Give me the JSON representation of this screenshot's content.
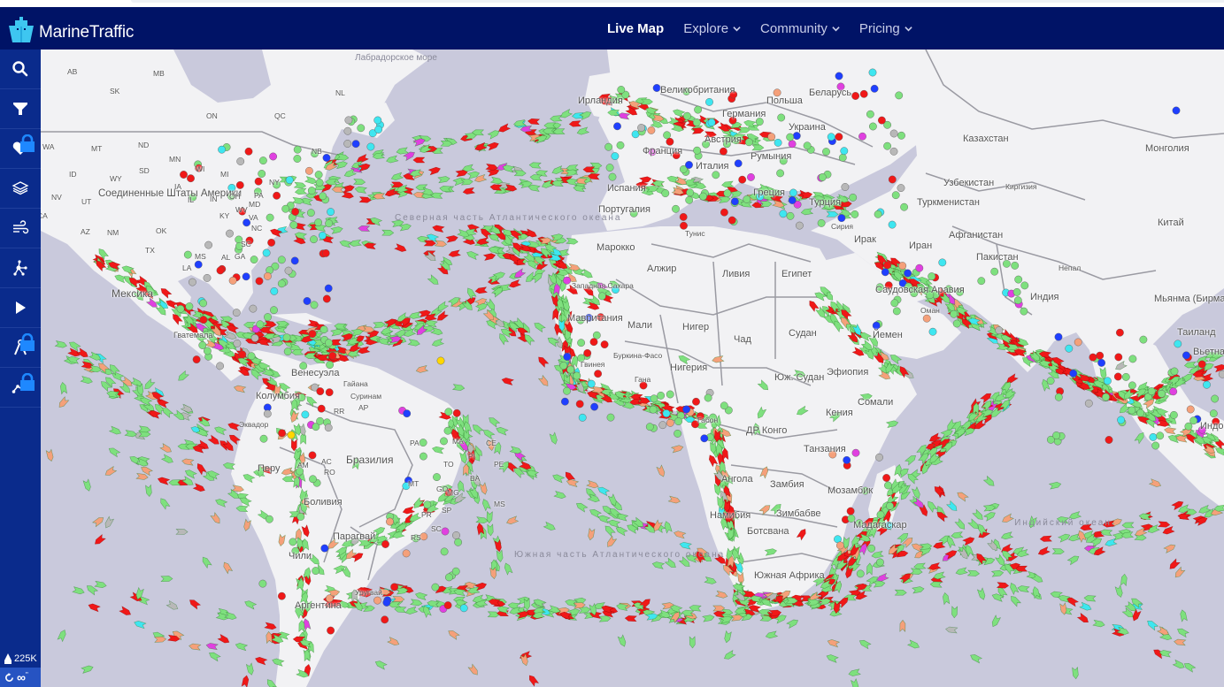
{
  "app": {
    "name": "MarineTraffic",
    "brand_color": "#001366",
    "sidebar_color": "#0a2b8c"
  },
  "nav": {
    "items": [
      {
        "label": "Live Map",
        "active": true,
        "dropdown": false
      },
      {
        "label": "Explore",
        "active": false,
        "dropdown": true
      },
      {
        "label": "Community",
        "active": false,
        "dropdown": true
      },
      {
        "label": "Pricing",
        "active": false,
        "dropdown": true
      }
    ]
  },
  "sidebar": {
    "items": [
      {
        "name": "search",
        "icon": "search-icon",
        "locked": false
      },
      {
        "name": "filters",
        "icon": "filter-icon",
        "locked": false
      },
      {
        "name": "my-fleets",
        "icon": "heart-icon",
        "locked": true
      },
      {
        "name": "map-layers",
        "icon": "layers-icon",
        "locked": false
      },
      {
        "name": "weather",
        "icon": "wind-icon",
        "locked": false
      },
      {
        "name": "density",
        "icon": "network-icon",
        "locked": false
      },
      {
        "name": "playback",
        "icon": "play-icon",
        "locked": false
      },
      {
        "name": "measure-distance",
        "icon": "compass-icon",
        "locked": true
      },
      {
        "name": "route-forecast",
        "icon": "route-icon",
        "locked": true
      }
    ],
    "vessel_count": "225K",
    "refresh_label": "∞",
    "refresh_suffix": "\""
  },
  "map": {
    "vessel_colors": {
      "cargo": "#7ee07e",
      "tanker": "#f01818",
      "passenger": "#1f3fff",
      "high_speed": "#ffd700",
      "tug_special": "#3ee6f0",
      "fishing": "#f5a07a",
      "pleasure": "#e040e0",
      "unknown": "#b8b8b8"
    },
    "labels": {
      "countries": [
        {
          "text": "Соединенные Штаты Америки",
          "kind": "usa"
        },
        {
          "text": "Мексика",
          "kind": "big"
        },
        {
          "text": "Гватемала",
          "kind": ""
        },
        {
          "text": "Венесуэла",
          "kind": ""
        },
        {
          "text": "Колумбия",
          "kind": ""
        },
        {
          "text": "Гайана",
          "kind": "state"
        },
        {
          "text": "Суринам",
          "kind": "state"
        },
        {
          "text": "Эквадор",
          "kind": "state"
        },
        {
          "text": "Перу",
          "kind": ""
        },
        {
          "text": "Бразилия",
          "kind": "big"
        },
        {
          "text": "Боливия",
          "kind": ""
        },
        {
          "text": "Парагвай",
          "kind": ""
        },
        {
          "text": "Уругвай",
          "kind": "state"
        },
        {
          "text": "Аргентина",
          "kind": ""
        },
        {
          "text": "Чили",
          "kind": ""
        },
        {
          "text": "Ирландия",
          "kind": ""
        },
        {
          "text": "Великобритания",
          "kind": ""
        },
        {
          "text": "Франция",
          "kind": ""
        },
        {
          "text": "Испания",
          "kind": ""
        },
        {
          "text": "Португалия",
          "kind": ""
        },
        {
          "text": "Германия",
          "kind": ""
        },
        {
          "text": "Польша",
          "kind": ""
        },
        {
          "text": "Беларусь",
          "kind": ""
        },
        {
          "text": "Украина",
          "kind": ""
        },
        {
          "text": "Австрия",
          "kind": ""
        },
        {
          "text": "Румыния",
          "kind": ""
        },
        {
          "text": "Италия",
          "kind": ""
        },
        {
          "text": "Греция",
          "kind": ""
        },
        {
          "text": "Турция",
          "kind": ""
        },
        {
          "text": "Сирия",
          "kind": "state"
        },
        {
          "text": "Тунис",
          "kind": "state"
        },
        {
          "text": "Марокко",
          "kind": ""
        },
        {
          "text": "Алжир",
          "kind": ""
        },
        {
          "text": "Ливия",
          "kind": ""
        },
        {
          "text": "Египет",
          "kind": ""
        },
        {
          "text": "Западная Сахара",
          "kind": "state"
        },
        {
          "text": "Мавритания",
          "kind": ""
        },
        {
          "text": "Мали",
          "kind": ""
        },
        {
          "text": "Нигер",
          "kind": ""
        },
        {
          "text": "Чад",
          "kind": ""
        },
        {
          "text": "Судан",
          "kind": ""
        },
        {
          "text": "Буркина-Фасо",
          "kind": "state"
        },
        {
          "text": "Гвинея",
          "kind": "state"
        },
        {
          "text": "Гана",
          "kind": "state"
        },
        {
          "text": "Нигерия",
          "kind": ""
        },
        {
          "text": "Габон",
          "kind": "state"
        },
        {
          "text": "Юж. Судан",
          "kind": ""
        },
        {
          "text": "Эфиопия",
          "kind": ""
        },
        {
          "text": "Сомали",
          "kind": ""
        },
        {
          "text": "Кения",
          "kind": ""
        },
        {
          "text": "ДР Конго",
          "kind": ""
        },
        {
          "text": "Танзания",
          "kind": ""
        },
        {
          "text": "Ангола",
          "kind": ""
        },
        {
          "text": "Замбия",
          "kind": ""
        },
        {
          "text": "Мозамбик",
          "kind": ""
        },
        {
          "text": "Намибия",
          "kind": ""
        },
        {
          "text": "Зимбабве",
          "kind": ""
        },
        {
          "text": "Ботсвана",
          "kind": ""
        },
        {
          "text": "Мадагаскар",
          "kind": ""
        },
        {
          "text": "Южная Африка",
          "kind": ""
        },
        {
          "text": "Ирак",
          "kind": ""
        },
        {
          "text": "Иран",
          "kind": ""
        },
        {
          "text": "Саудовская Аравия",
          "kind": ""
        },
        {
          "text": "Йемен",
          "kind": ""
        },
        {
          "text": "Оман",
          "kind": "state"
        },
        {
          "text": "Казахстан",
          "kind": ""
        },
        {
          "text": "Узбекистан",
          "kind": ""
        },
        {
          "text": "Киргизия",
          "kind": "state"
        },
        {
          "text": "Туркменистан",
          "kind": ""
        },
        {
          "text": "Афганистан",
          "kind": ""
        },
        {
          "text": "Пакистан",
          "kind": ""
        },
        {
          "text": "Непал",
          "kind": "state"
        },
        {
          "text": "Индия",
          "kind": ""
        },
        {
          "text": "Китай",
          "kind": ""
        },
        {
          "text": "Монголия",
          "kind": ""
        },
        {
          "text": "Мьянма (Бирма)",
          "kind": ""
        },
        {
          "text": "Таиланд",
          "kind": ""
        },
        {
          "text": "Вьетнам",
          "kind": ""
        },
        {
          "text": "Индонезия",
          "kind": ""
        }
      ],
      "states": [
        "AB",
        "SK",
        "MB",
        "ON",
        "QC",
        "NL",
        "WA",
        "MT",
        "ND",
        "MN",
        "WI",
        "MI",
        "NY",
        "NB",
        "ID",
        "WY",
        "SD",
        "IA",
        "IL",
        "IN",
        "OH",
        "PA",
        "MD",
        "NV",
        "UT",
        "CA",
        "AZ",
        "NM",
        "TX",
        "OK",
        "KY",
        "WV",
        "VA",
        "NC",
        "SC",
        "GA",
        "AL",
        "MS",
        "LA",
        "RR",
        "AP",
        "AM",
        "PA",
        "MA",
        "CE",
        "PI",
        "PE",
        "AC",
        "RO",
        "TO",
        "BA",
        "MT",
        "GO",
        "MG",
        "MS",
        "SP",
        "PR",
        "SC",
        "RS"
      ],
      "seas": [
        {
          "text": "Лабрадорское море"
        },
        {
          "text": "Северная часть Атлантического океана"
        },
        {
          "text": "Южная часть Атлантического океана"
        },
        {
          "text": "Индийский океан"
        }
      ]
    }
  }
}
